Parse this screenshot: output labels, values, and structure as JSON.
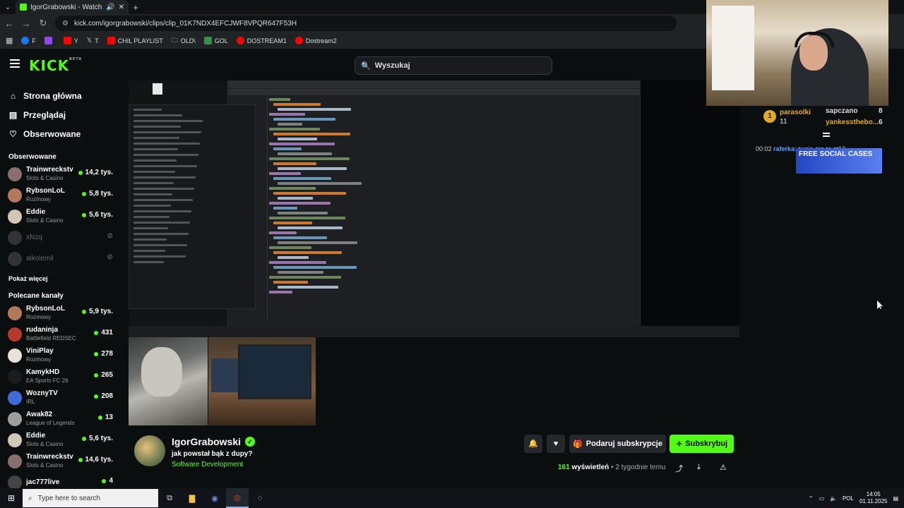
{
  "browser": {
    "tab_title": "IgorGrabowski - Watch clip",
    "url": "kick.com/igorgrabowski/clips/clip_01K7NDX4EFCJWF8VPQR647F53H",
    "bookmarks": [
      "F",
      "",
      "Y",
      "T",
      "CHIL PLAYLIST",
      "OLD\\",
      "GOL",
      "DOSTREAM1",
      "Dostream2"
    ]
  },
  "header": {
    "logo": "KICK",
    "logo_beta": "BETA",
    "search_placeholder": "Wyszukaj"
  },
  "sidebar": {
    "nav": [
      {
        "label": "Strona główna",
        "icon": "home-icon"
      },
      {
        "label": "Przeglądaj",
        "icon": "browse-icon"
      },
      {
        "label": "Obserwowane",
        "icon": "heart-icon"
      }
    ],
    "followed_title": "Obserwowane",
    "followed": [
      {
        "name": "Trainwreckstv",
        "category": "Slots & Casino",
        "viewers": "14,2 tys.",
        "color": "#8a6f6f",
        "online": true
      },
      {
        "name": "RybsonLoL",
        "category": "Rozmowy",
        "viewers": "5,8 tys.",
        "color": "#b27a5a",
        "online": true
      },
      {
        "name": "Eddie",
        "category": "Slots & Casino",
        "viewers": "5,6 tys.",
        "color": "#d0c7b8",
        "online": true
      },
      {
        "name": "xNzq",
        "category": "",
        "viewers": "",
        "color": "#333333",
        "online": false
      },
      {
        "name": "aikoiemil",
        "category": "",
        "viewers": "",
        "color": "#333333",
        "online": false
      }
    ],
    "show_more": "Pokaż więcej",
    "recommended_title": "Polecane kanały",
    "recommended": [
      {
        "name": "RybsonLoL",
        "category": "Rozmowy",
        "viewers": "5,9 tys.",
        "color": "#b27a5a"
      },
      {
        "name": "rudaninja",
        "category": "Battlefield REDSEC",
        "viewers": "431",
        "color": "#b43b2b"
      },
      {
        "name": "ViniPlay",
        "category": "Rozmowy",
        "viewers": "278",
        "color": "#e8e2d8"
      },
      {
        "name": "KamykHD",
        "category": "EA Sports FC 26",
        "viewers": "265",
        "color": "#1c1c1c"
      },
      {
        "name": "WoznyTV",
        "category": "IRL",
        "viewers": "208",
        "color": "#3f6bd6"
      },
      {
        "name": "Awak82",
        "category": "League of Legends",
        "viewers": "13",
        "color": "#9d9d9d"
      },
      {
        "name": "Eddie",
        "category": "Slots & Casino",
        "viewers": "5,6 tys.",
        "color": "#d0c7b8"
      },
      {
        "name": "Trainwreckstv",
        "category": "Slots & Casino",
        "viewers": "14,6 tys.",
        "color": "#8a6f6f"
      },
      {
        "name": "jac777live",
        "category": "",
        "viewers": "4",
        "color": "#444444"
      }
    ]
  },
  "chat": {
    "leaders": [
      {
        "name": "parasolki",
        "count": "11"
      },
      {
        "name": "sapczano",
        "count": "8"
      },
      {
        "name": "yankessthebo...",
        "count": "6"
      }
    ],
    "message_time": "00:02",
    "message_user": "raferka:",
    "message_text": "twoja gra to gt12",
    "ad_text": "FREE SOCIAL CASES"
  },
  "clip": {
    "channel": "IgorGrabowski",
    "title": "jak powstał bąk z dupy?",
    "category": "Software Development",
    "gift_label": "Podaruj subskrypcje",
    "subscribe_label": "Subskrybuj",
    "views_count": "161",
    "views_label": "wyświetleń",
    "age": "• 2 tygodnie temu"
  },
  "taskbar": {
    "search_placeholder": "Type here to search",
    "lang": "POL",
    "time": "14:05",
    "date": "01.11.2025"
  }
}
